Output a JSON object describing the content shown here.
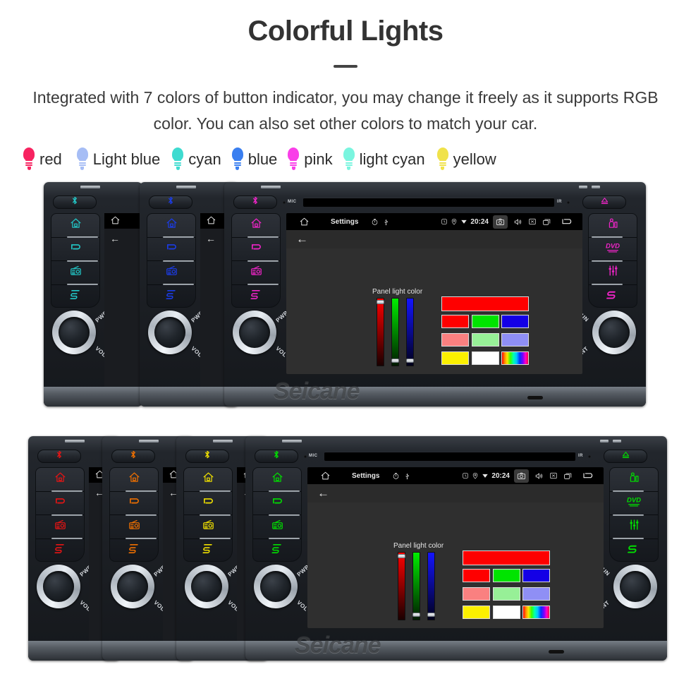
{
  "header": {
    "title": "Colorful Lights",
    "subtitle": "Integrated with 7 colors of button indicator, you may change it freely as it supports RGB color. You can also set other colors to match your car."
  },
  "legend": {
    "items": [
      {
        "label": "red",
        "color": "#f72360"
      },
      {
        "label": "Light blue",
        "color": "#a6bdf5"
      },
      {
        "label": "cyan",
        "color": "#3fdbd0"
      },
      {
        "label": "blue",
        "color": "#3a7ff0"
      },
      {
        "label": "pink",
        "color": "#f93fe8"
      },
      {
        "label": "light cyan",
        "color": "#7af5df"
      },
      {
        "label": "yellow",
        "color": "#f0e24a"
      }
    ]
  },
  "screen": {
    "statusbar": {
      "home_icon": "home-icon",
      "title": "Settings",
      "timer_icon": "timer-icon",
      "usb_icon": "usb-icon",
      "alarm_icon": "alarm-icon",
      "location_icon": "location-pin-icon",
      "download_icon": "download-icon",
      "clock": "20:24",
      "camera_icon": "camera-icon",
      "volume_icon": "volume-icon",
      "close_icon": "close-box-icon",
      "recents_icon": "recents-icon",
      "back_icon": "back-arrow-icon"
    },
    "back_arrow": "←",
    "panel_label": "Panel light color",
    "sliders": [
      {
        "name": "red",
        "track_top": "#ff0000",
        "track_bottom": "#1a0000",
        "value": 100
      },
      {
        "name": "green",
        "track_top": "#00ee00",
        "track_bottom": "#001a00",
        "value": 0
      },
      {
        "name": "blue",
        "track_top": "#1414ff",
        "track_bottom": "#00001a",
        "value": 0
      }
    ],
    "preview_color": "#fe0000",
    "swatches": [
      {
        "name": "red",
        "color": "#fe0000"
      },
      {
        "name": "green",
        "color": "#00e400"
      },
      {
        "name": "blue",
        "color": "#1400e6"
      },
      {
        "name": "light-red",
        "color": "#fa8080"
      },
      {
        "name": "light-green",
        "color": "#97f097"
      },
      {
        "name": "light-blue",
        "color": "#8f8ff5"
      },
      {
        "name": "yellow",
        "color": "#fbf000"
      },
      {
        "name": "white",
        "color": "#ffffff"
      },
      {
        "name": "rainbow",
        "color": "rainbow"
      }
    ]
  },
  "unit": {
    "mic_label": "MIC",
    "ir_label": "IR",
    "knob_left_top": "PWR",
    "knob_left_bottom": "VOL",
    "knob_right_top": "TUN",
    "knob_right_bottom": "ENT",
    "left_buttons": [
      "home-icon",
      "return-icon",
      "radio-icon",
      "sd-card-icon"
    ],
    "right_buttons": [
      "navigation-icon",
      "dvd-icon",
      "equalizer-icon",
      "sd-icon"
    ],
    "bluetooth_icon": "bluetooth-icon",
    "eject_icon": "eject-icon"
  },
  "watermark": {
    "text": "Seicane"
  },
  "rows": {
    "top": {
      "units": [
        {
          "name": "cyan-unit",
          "color": "#22c8c8"
        },
        {
          "name": "blue-unit",
          "color": "#1b3ce8"
        },
        {
          "name": "magenta-unit",
          "color": "#f024c8"
        }
      ]
    },
    "bottom": {
      "units": [
        {
          "name": "red-unit",
          "color": "#e81414"
        },
        {
          "name": "orange-unit",
          "color": "#f07000"
        },
        {
          "name": "yellow-unit",
          "color": "#f0e000"
        },
        {
          "name": "green-unit",
          "color": "#00e000"
        }
      ]
    }
  }
}
